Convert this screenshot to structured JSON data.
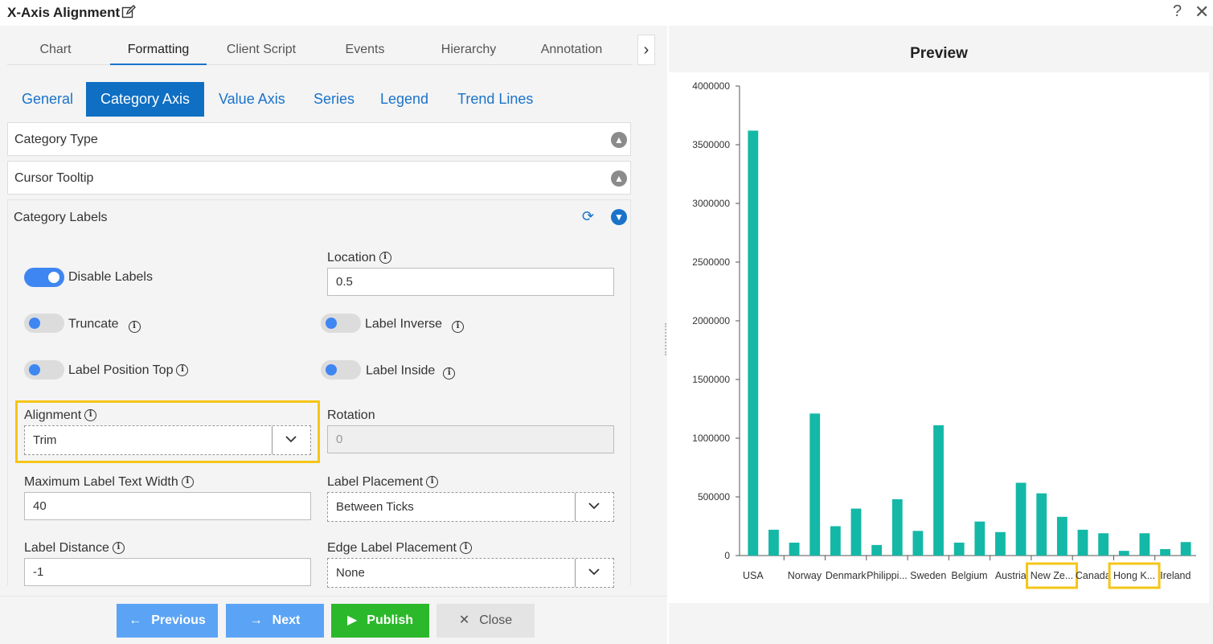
{
  "window": {
    "title": "X-Axis Alignment",
    "help": "?",
    "close": "✕"
  },
  "top_tabs": [
    {
      "label": "Chart",
      "active": false
    },
    {
      "label": "Formatting",
      "active": true
    },
    {
      "label": "Client Script",
      "active": false
    },
    {
      "label": "Events",
      "active": false
    },
    {
      "label": "Hierarchy",
      "active": false
    },
    {
      "label": "Annotation",
      "active": false
    }
  ],
  "sub_tabs": [
    {
      "label": "General",
      "active": false
    },
    {
      "label": "Category Axis",
      "active": true
    },
    {
      "label": "Value Axis",
      "active": false
    },
    {
      "label": "Series",
      "active": false
    },
    {
      "label": "Legend",
      "active": false
    },
    {
      "label": "Trend Lines",
      "active": false
    }
  ],
  "panels": {
    "category_type": "Category Type",
    "cursor_tooltip": "Cursor Tooltip",
    "category_labels": "Category Labels"
  },
  "form": {
    "disable_labels": {
      "label": "Disable Labels",
      "on": true
    },
    "truncate": {
      "label": "Truncate",
      "on": false
    },
    "label_position_top": {
      "label": "Label Position Top",
      "on": false
    },
    "label_inverse": {
      "label": "Label Inverse",
      "on": false
    },
    "label_inside": {
      "label": "Label Inside",
      "on": false
    },
    "location": {
      "label": "Location",
      "value": "0.5"
    },
    "alignment": {
      "label": "Alignment",
      "value": "Trim"
    },
    "rotation": {
      "label": "Rotation",
      "value": "0"
    },
    "max_label_width": {
      "label": "Maximum Label Text Width",
      "value": "40"
    },
    "label_placement": {
      "label": "Label Placement",
      "value": "Between Ticks"
    },
    "label_distance": {
      "label": "Label Distance",
      "value": "-1"
    },
    "edge_label_placement": {
      "label": "Edge Label Placement",
      "value": "None"
    }
  },
  "footer": {
    "previous": "Previous",
    "next": "Next",
    "publish": "Publish",
    "close": "Close"
  },
  "preview": {
    "title": "Preview"
  },
  "colors": {
    "accent": "#1a73c9",
    "bar": "#14b8a6",
    "highlight": "#f5c518",
    "publish": "#2bb82b"
  },
  "chart_data": {
    "type": "bar",
    "ylim": [
      0,
      4000000
    ],
    "yticks": [
      "0",
      "500000",
      "1000000",
      "1500000",
      "2000000",
      "2500000",
      "3000000",
      "3500000",
      "4000000"
    ],
    "categories": [
      "USA",
      "",
      "Norway",
      "Denmark",
      "Philippi...",
      "",
      "Sweden",
      "",
      "Belgium",
      "",
      "Austria",
      "",
      "New Ze...",
      "",
      "Canada",
      "",
      "Hong K...",
      "",
      "Ireland",
      ""
    ],
    "x_labels": [
      {
        "text": "USA",
        "index": 0
      },
      {
        "text": "Norway",
        "index": 2
      },
      {
        "text": "Denmark",
        "index": 4
      },
      {
        "text": "Philippi...",
        "index": 6
      },
      {
        "text": "Sweden",
        "index": 8
      },
      {
        "text": "Belgium",
        "index": 10
      },
      {
        "text": "Austria",
        "index": 12
      },
      {
        "text": "New Ze...",
        "index": 14,
        "highlight": true
      },
      {
        "text": "Canada",
        "index": 16
      },
      {
        "text": "Hong K...",
        "index": 18,
        "highlight": true
      },
      {
        "text": "Ireland",
        "index": 20
      }
    ],
    "values": [
      3620000,
      220000,
      110000,
      1210000,
      250000,
      400000,
      90000,
      480000,
      210000,
      1110000,
      110000,
      290000,
      200000,
      620000,
      530000,
      330000,
      220000,
      190000,
      40000,
      190000,
      55000,
      115000
    ]
  }
}
